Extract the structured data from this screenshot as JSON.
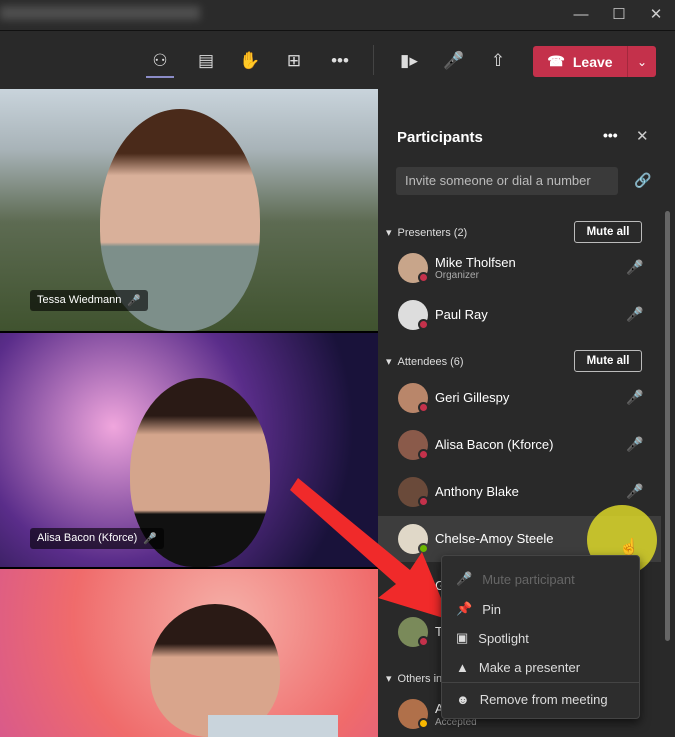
{
  "toolbar": {
    "leave_label": "Leave"
  },
  "video": [
    {
      "name": "Tessa Wiedmann"
    },
    {
      "name": "Alisa Bacon (Kforce)"
    }
  ],
  "panel": {
    "title": "Participants",
    "invite_placeholder": "Invite someone or dial a number",
    "presenters": {
      "label": "Presenters (2)",
      "mute_all": "Mute all",
      "items": [
        {
          "name": "Mike Tholfsen",
          "role": "Organizer"
        },
        {
          "name": "Paul Ray"
        }
      ]
    },
    "attendees": {
      "label": "Attendees (6)",
      "mute_all": "Mute all",
      "items": [
        {
          "name": "Geri Gillespy"
        },
        {
          "name": "Alisa Bacon (Kforce)"
        },
        {
          "name": "Anthony Blake"
        },
        {
          "name": "Chelse-Amoy Steele"
        },
        {
          "name": "G"
        },
        {
          "name": "T"
        }
      ]
    },
    "others": {
      "label": "Others in",
      "items": [
        {
          "name": "A",
          "status": "Accepted"
        }
      ]
    }
  },
  "menu": {
    "items": [
      "Mute participant",
      "Pin",
      "Spotlight",
      "Make a presenter",
      "Remove from meeting"
    ]
  },
  "colors": {
    "leave": "#c4314b",
    "accent": "#8b8cc7",
    "status_busy": "#c4314b"
  }
}
